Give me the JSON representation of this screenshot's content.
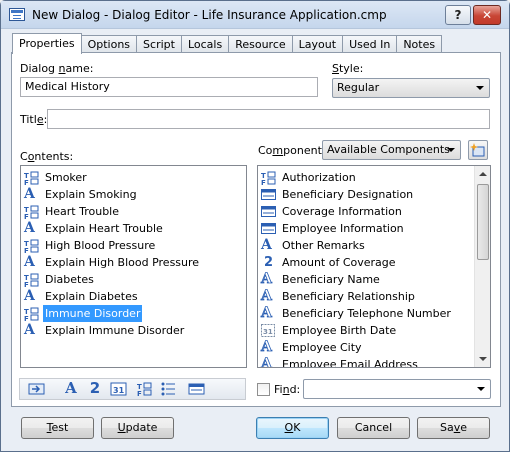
{
  "window": {
    "title": "New Dialog - Dialog Editor - Life Insurance Application.cmp",
    "help_label": "?",
    "close_label": "✕"
  },
  "tabs": [
    "Properties",
    "Options",
    "Script",
    "Locals",
    "Resource",
    "Layout",
    "Used In",
    "Notes"
  ],
  "active_tab": "Properties",
  "dialog_name": {
    "label_pre": "Dialog ",
    "label_u": "n",
    "label_post": "ame:",
    "value": "Medical History"
  },
  "style": {
    "label_u": "S",
    "label_post": "tyle:",
    "value": "Regular"
  },
  "title_field": {
    "label_pre": "Titl",
    "label_u": "e",
    "label_post": ":",
    "value": ""
  },
  "contents": {
    "label_pre": "C",
    "label_u": "o",
    "label_post": "ntents:",
    "items": [
      {
        "icon": "field-icon",
        "label": "Smoker"
      },
      {
        "icon": "text-icon",
        "label": "Explain Smoking"
      },
      {
        "icon": "field-icon",
        "label": "Heart Trouble"
      },
      {
        "icon": "text-icon",
        "label": "Explain Heart Trouble"
      },
      {
        "icon": "field-icon",
        "label": "High Blood Pressure"
      },
      {
        "icon": "text-icon",
        "label": "Explain High Blood Pressure"
      },
      {
        "icon": "field-icon",
        "label": "Diabetes"
      },
      {
        "icon": "text-icon",
        "label": "Explain Diabetes"
      },
      {
        "icon": "field-icon",
        "label": "Immune Disorder",
        "selected": true
      },
      {
        "icon": "text-icon",
        "label": "Explain Immune Disorder"
      }
    ]
  },
  "components": {
    "label_pre": "Co",
    "label_u": "m",
    "label_post": "ponents:",
    "filter": "Available Components",
    "items": [
      {
        "icon": "field-icon",
        "label": "Authorization"
      },
      {
        "icon": "group-icon",
        "label": "Beneficiary Designation"
      },
      {
        "icon": "group-icon",
        "label": "Coverage Information"
      },
      {
        "icon": "group-icon",
        "label": "Employee Information"
      },
      {
        "icon": "text-icon",
        "label": "Other Remarks"
      },
      {
        "icon": "number-icon",
        "label": "Amount of Coverage"
      },
      {
        "icon": "text-outline-icon",
        "label": "Beneficiary Name"
      },
      {
        "icon": "text-outline-icon",
        "label": "Beneficiary Relationship"
      },
      {
        "icon": "text-outline-icon",
        "label": "Beneficiary Telephone Number"
      },
      {
        "icon": "date-icon",
        "label": "Employee Birth Date"
      },
      {
        "icon": "text-outline-icon",
        "label": "Employee City"
      },
      {
        "icon": "text-outline-icon",
        "label": "Employee Email Address"
      }
    ]
  },
  "find": {
    "label_pre": "Fi",
    "label_u": "n",
    "label_post": "d:",
    "value": ""
  },
  "buttons": {
    "test": {
      "u": "T",
      "rest": "est"
    },
    "update": {
      "u": "U",
      "rest": "pdate"
    },
    "ok": {
      "u": "O",
      "rest": "K"
    },
    "cancel": {
      "u": "",
      "rest": "Cancel"
    },
    "save": {
      "pre": "Sa",
      "u": "v",
      "rest": "e"
    }
  },
  "colors": {
    "accent": "#2b5fb3",
    "selection": "#3399ff"
  }
}
